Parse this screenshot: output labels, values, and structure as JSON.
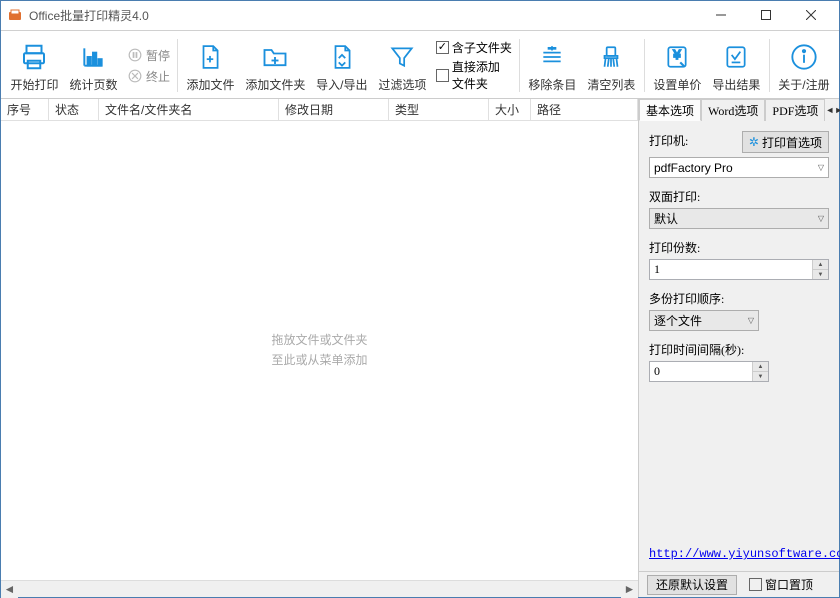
{
  "window": {
    "title": "Office批量打印精灵4.0"
  },
  "toolbar": {
    "start_print": "开始打印",
    "stat_pages": "统计页数",
    "pause": "暂停",
    "stop": "终止",
    "add_file": "添加文件",
    "add_folder": "添加文件夹",
    "import_export": "导入/导出",
    "filter": "过滤选项",
    "include_sub": "含子文件夹",
    "direct_add": "直接添加\n文件夹",
    "direct_add_line1": "直接添加",
    "direct_add_line2": "文件夹",
    "remove": "移除条目",
    "clear": "清空列表",
    "set_price": "设置单价",
    "export_result": "导出结果",
    "about": "关于/注册"
  },
  "columns": {
    "seq": "序号",
    "status": "状态",
    "filename": "文件名/文件夹名",
    "mdate": "修改日期",
    "type": "类型",
    "size": "大小",
    "path": "路径"
  },
  "placeholder": {
    "l1": "拖放文件或文件夹",
    "l2": "至此或从菜单添加"
  },
  "tabs": {
    "basic": "基本选项",
    "word": "Word选项",
    "pdf": "PDF选项"
  },
  "panel": {
    "printer_lbl": "打印机:",
    "printer_pref": "打印首选项",
    "printer_val": "pdfFactory Pro",
    "duplex_lbl": "双面打印:",
    "duplex_val": "默认",
    "copies_lbl": "打印份数:",
    "copies_val": "1",
    "order_lbl": "多份打印顺序:",
    "order_val": "逐个文件",
    "interval_lbl": "打印时间间隔(秒):",
    "interval_val": "0",
    "link": "http://www.yiyunsoftware.com/"
  },
  "footer": {
    "restore": "还原默认设置",
    "topmost": "窗口置顶"
  }
}
